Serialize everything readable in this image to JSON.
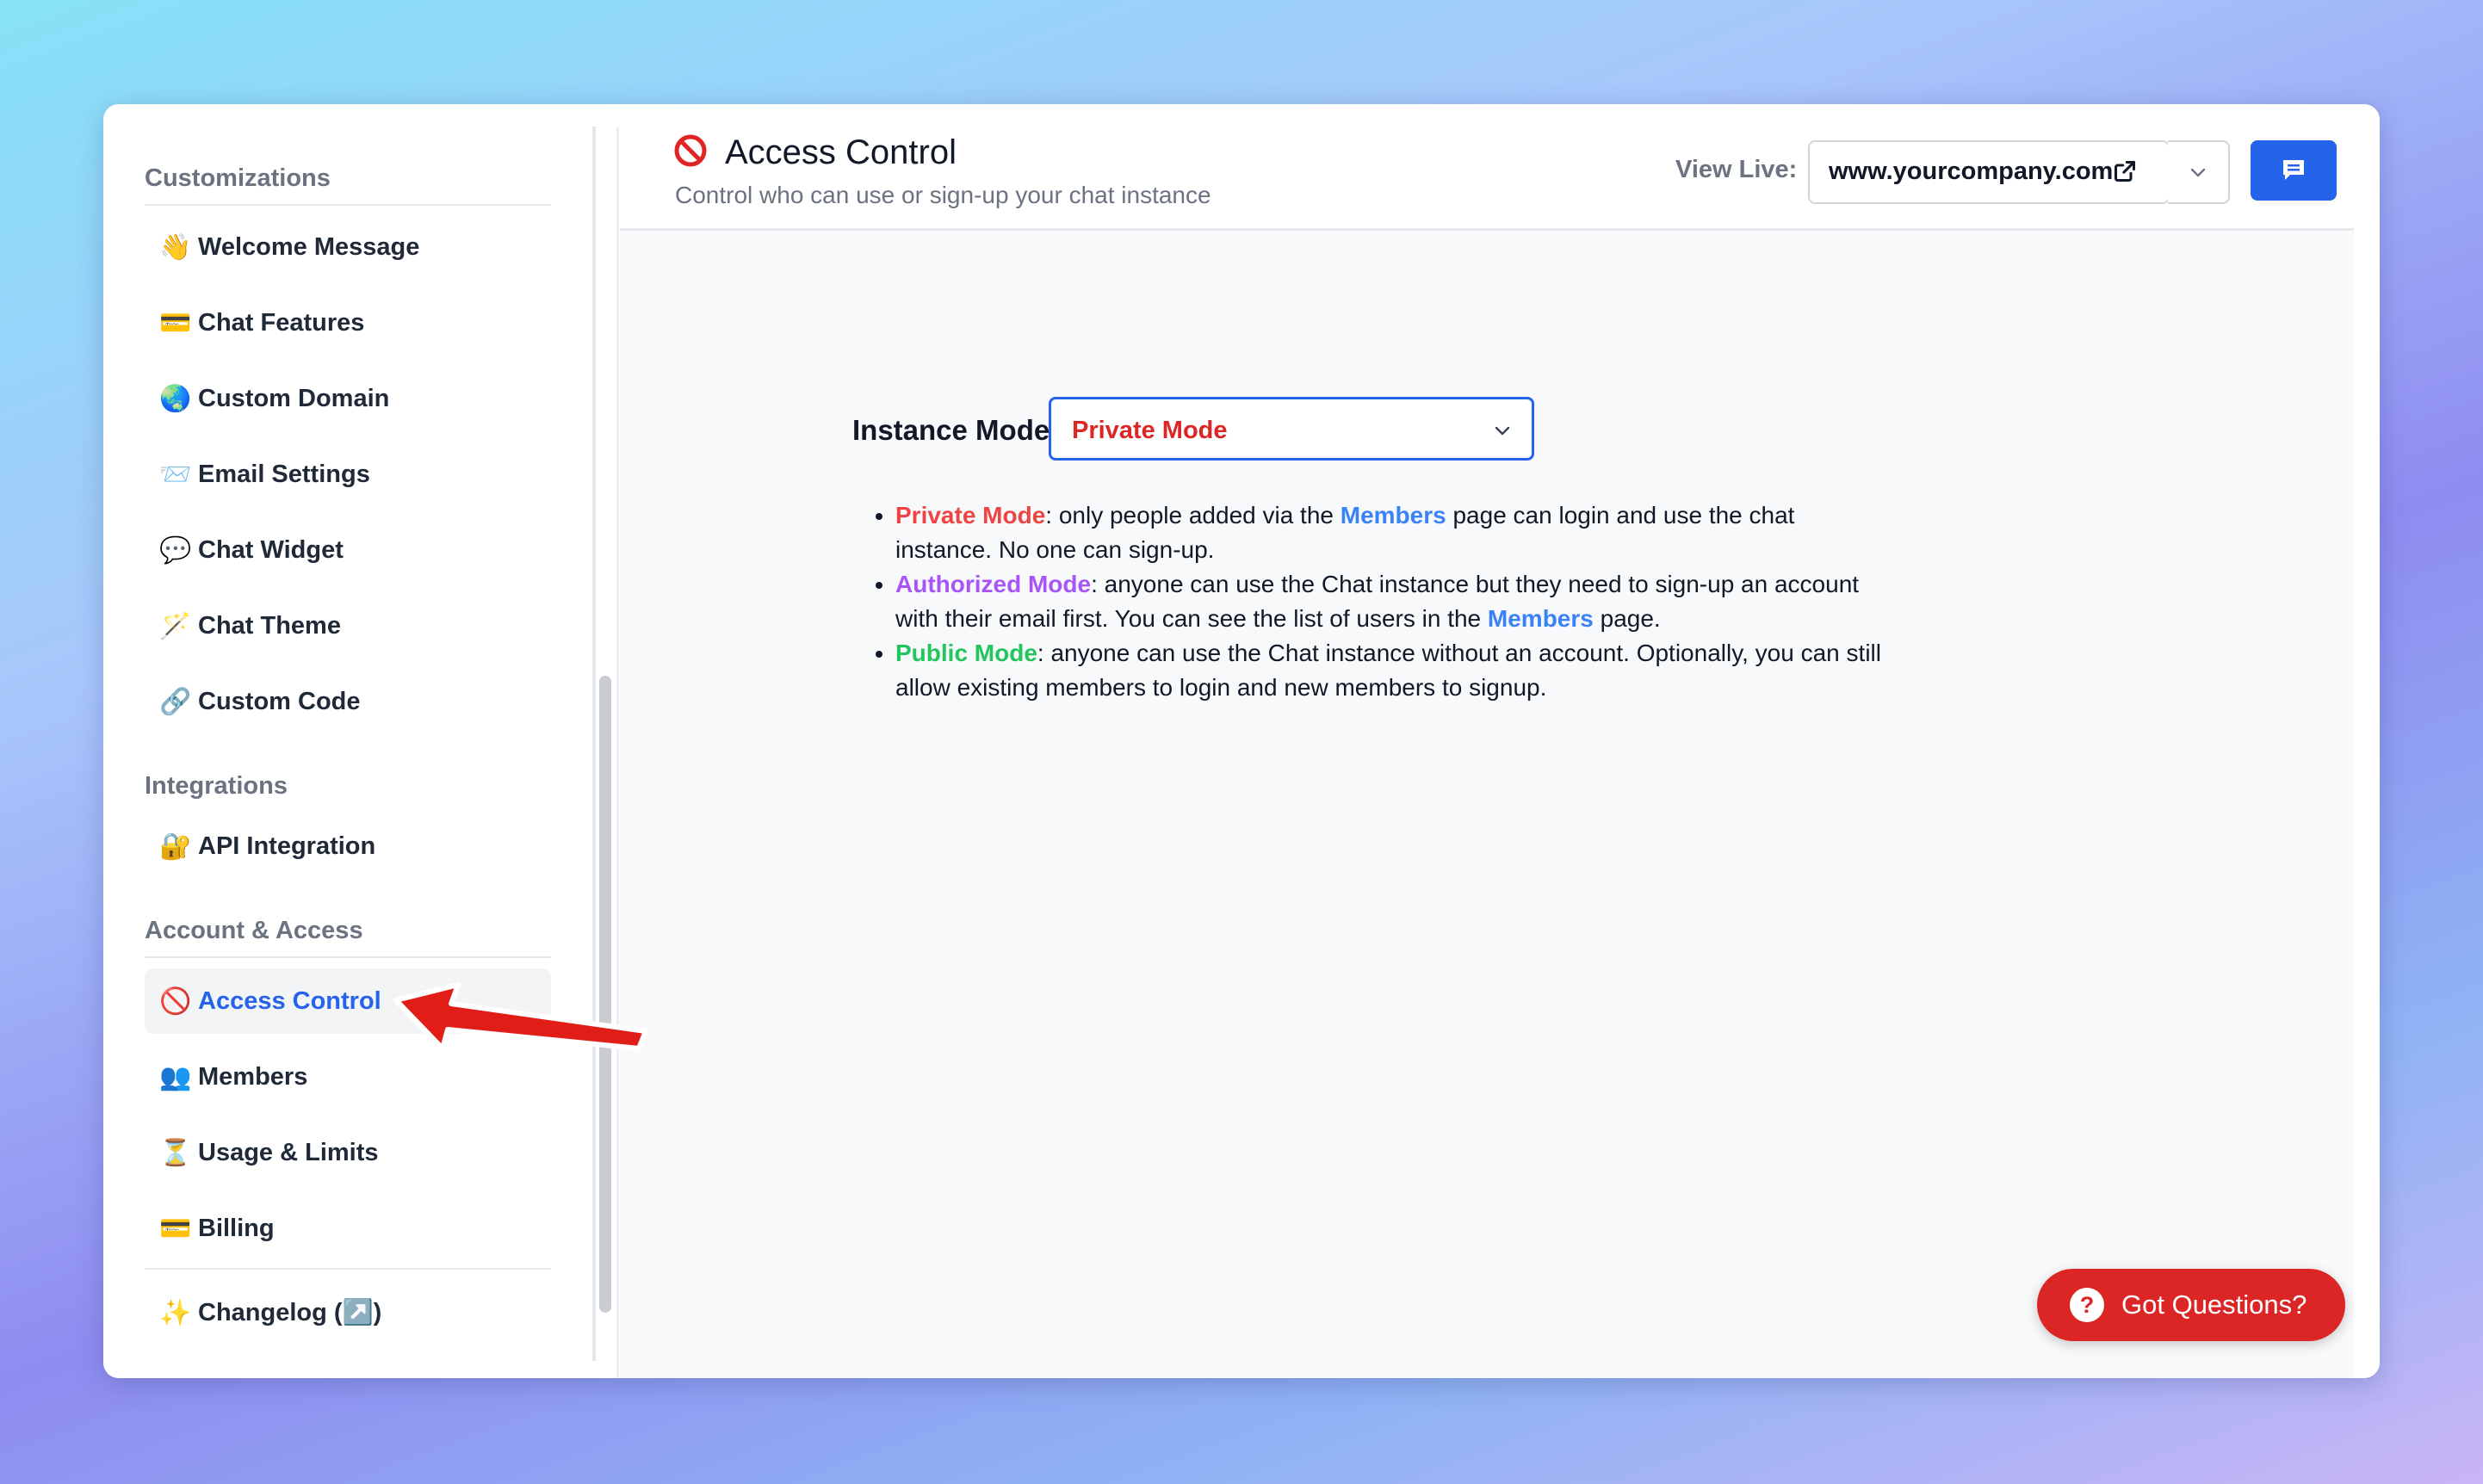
{
  "sidebar": {
    "sections": {
      "customizations": "Customizations",
      "integrations": "Integrations",
      "account_access": "Account & Access"
    },
    "items": [
      {
        "emoji": "👋",
        "label": "Welcome Message"
      },
      {
        "emoji": "💳",
        "label": "Chat Features"
      },
      {
        "emoji": "🌏",
        "label": "Custom Domain"
      },
      {
        "emoji": "📨",
        "label": "Email Settings"
      },
      {
        "emoji": "💬",
        "label": "Chat Widget"
      },
      {
        "emoji": "🪄",
        "label": "Chat Theme"
      },
      {
        "emoji": "🔗",
        "label": "Custom Code"
      },
      {
        "emoji": "🔐",
        "label": "API Integration"
      },
      {
        "emoji": "🚫",
        "label": "Access Control"
      },
      {
        "emoji": "👥",
        "label": "Members"
      },
      {
        "emoji": "⏳",
        "label": "Usage & Limits"
      },
      {
        "emoji": "💳",
        "label": "Billing"
      },
      {
        "emoji": "✨",
        "label": "Changelog (↗️)"
      }
    ],
    "active_item": "Access Control"
  },
  "header": {
    "title": "Access Control",
    "subtitle": "Control who can use or sign-up your chat instance",
    "view_live_label": "View Live:",
    "url": "www.yourcompany.com"
  },
  "instance": {
    "label": "Instance Mode:",
    "selected": "Private Mode"
  },
  "descriptions": {
    "private": {
      "name": "Private Mode",
      "text1": ": only people added via the ",
      "link": "Members",
      "text2": " page can login and use the chat instance. No one can sign-up."
    },
    "authorized": {
      "name": "Authorized Mode",
      "text1": ": anyone can use the Chat instance but they need to sign-up an account with their email first. You can see the list of users in the ",
      "link": "Members",
      "text2": " page."
    },
    "public": {
      "name": "Public Mode",
      "text1": ": anyone can use the Chat instance without an account. Optionally, you can still allow existing members to login and new members to signup."
    }
  },
  "help_button": {
    "icon": "?",
    "label": "Got Questions?"
  },
  "colors": {
    "accent": "#2563eb",
    "private": "#ef4444",
    "authorized": "#a855f7",
    "public": "#22c55e",
    "help": "#dc2626"
  }
}
